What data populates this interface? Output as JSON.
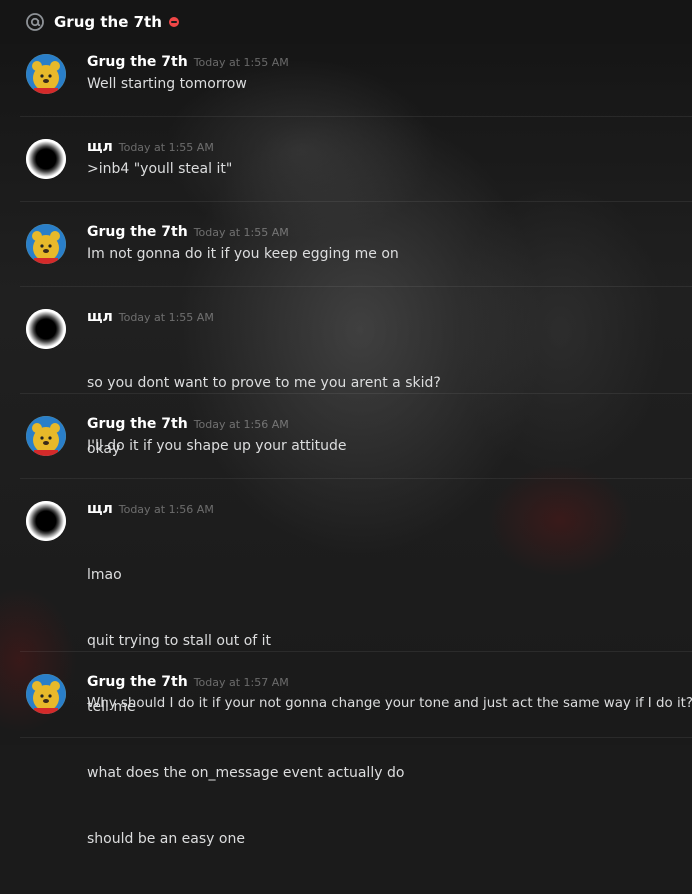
{
  "channel": {
    "title": "Grug the 7th",
    "at_icon": "at-icon",
    "status_icon": "dnd-status-icon",
    "status_color": "#f04747"
  },
  "messages": [
    {
      "author": "Grug the 7th",
      "timestamp": "Today at 1:55 AM",
      "avatar": "winnie-pooh-avatar",
      "lines": [
        "Well starting tomorrow"
      ]
    },
    {
      "author": "щл",
      "timestamp": "Today at 1:55 AM",
      "avatar": "eclipse-avatar",
      "lines": [
        ">inb4 \"youll steal it\""
      ]
    },
    {
      "author": "Grug the 7th",
      "timestamp": "Today at 1:55 AM",
      "avatar": "winnie-pooh-avatar",
      "lines": [
        "Im not gonna do it if you keep egging me on"
      ]
    },
    {
      "author": "щл",
      "timestamp": "Today at 1:55 AM",
      "avatar": "eclipse-avatar",
      "lines": [
        "so you dont want to prove to me you arent a skid?",
        "okay"
      ]
    },
    {
      "author": "Grug the 7th",
      "timestamp": "Today at 1:56 AM",
      "avatar": "winnie-pooh-avatar",
      "lines": [
        "I'll do it if you shape up your attitude"
      ]
    },
    {
      "author": "щл",
      "timestamp": "Today at 1:56 AM",
      "avatar": "eclipse-avatar",
      "lines": [
        "lmao",
        "quit trying to stall out of it",
        "tell me",
        "what does the on_message event actually do",
        "should be an easy one"
      ]
    },
    {
      "author": "Grug the 7th",
      "timestamp": "Today at 1:57 AM",
      "avatar": "winnie-pooh-avatar",
      "lines": [
        "Why should I do it if your not gonna change your tone and just act the same way if I do it?"
      ]
    }
  ]
}
